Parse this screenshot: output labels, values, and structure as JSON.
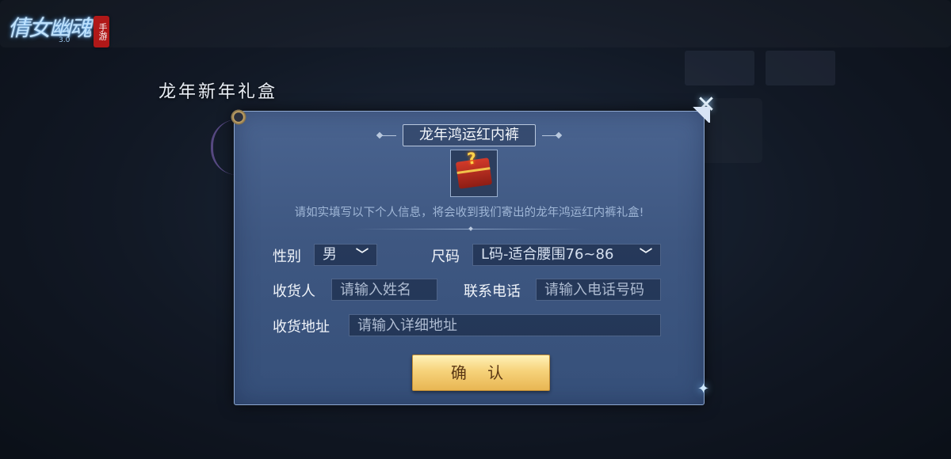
{
  "app": {
    "logo_text": "倩女幽魂",
    "logo_version": "3.0",
    "logo_seal": "手游"
  },
  "page": {
    "title": "龙年新年礼盒"
  },
  "dialog": {
    "title": "龙年鸿运红内裤",
    "description": "请如实填写以下个人信息，将会收到我们寄出的龙年鸿运红内裤礼盒!",
    "gift_icon_symbol": "?",
    "gender": {
      "label": "性别",
      "value": "男"
    },
    "size": {
      "label": "尺码",
      "value": "L码-适合腰围76~86"
    },
    "recipient": {
      "label": "收货人",
      "placeholder": "请输入姓名"
    },
    "phone": {
      "label": "联系电话",
      "placeholder": "请输入电话号码"
    },
    "address": {
      "label": "收货地址",
      "placeholder": "请输入详细地址"
    },
    "confirm_label": "确 认",
    "close_symbol": "✕"
  },
  "colors": {
    "accent_gold": "#f6d27a",
    "panel_blue": "#3e5781"
  }
}
